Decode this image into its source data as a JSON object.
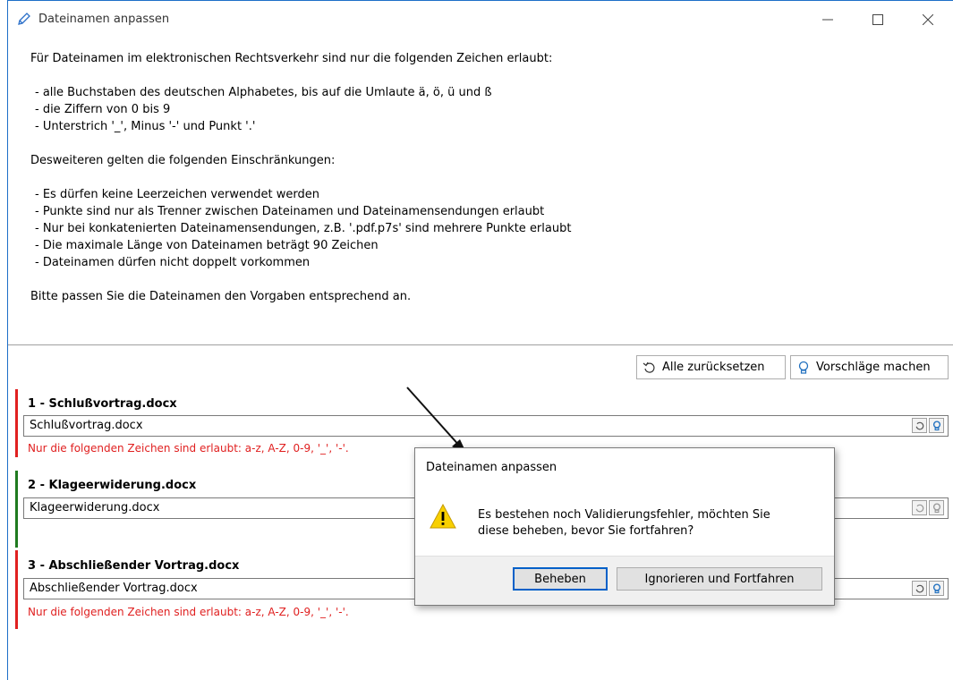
{
  "window": {
    "title": "Dateinamen anpassen"
  },
  "intro": {
    "heading1": "Für Dateinamen im elektronischen Rechtsverkehr sind nur die folgenden Zeichen erlaubt:",
    "allowed": [
      "- alle Buchstaben des deutschen Alphabetes, bis auf die Umlaute ä, ö, ü und ß",
      "- die Ziffern von 0 bis 9",
      "- Unterstrich '_', Minus '-' und Punkt '.'"
    ],
    "heading2": "Desweiteren gelten die folgenden Einschränkungen:",
    "restrictions": [
      "- Es dürfen keine Leerzeichen verwendet werden",
      "- Punkte sind nur als Trenner zwischen Dateinamen und Dateinamensendungen erlaubt",
      "- Nur bei konkatenierten Dateinamensendungen, z.B. '.pdf.p7s' sind mehrere Punkte erlaubt",
      "- Die maximale Länge von Dateinamen beträgt 90 Zeichen",
      "- Dateinamen dürfen nicht doppelt vorkommen"
    ],
    "closing": "Bitte passen Sie die Dateinamen den Vorgaben entsprechend an."
  },
  "toolbar": {
    "reset_label": "Alle zurücksetzen",
    "suggest_label": "Vorschläge machen"
  },
  "entries": [
    {
      "title": "1  - Schlußvortrag.docx",
      "value": "Schlußvortrag.docx",
      "error": "Nur die folgenden Zeichen sind erlaubt: a-z, A-Z, 0-9, '_', '-'.",
      "status": "error"
    },
    {
      "title": "2  - Klageerwiderung.docx",
      "value": "Klageerwiderung.docx",
      "error": "",
      "status": "ok"
    },
    {
      "title": "3  - Abschließender Vortrag.docx",
      "value": "Abschließender Vortrag.docx",
      "error": "Nur die folgenden Zeichen sind erlaubt: a-z, A-Z, 0-9, '_', '-'.",
      "status": "error"
    }
  ],
  "dialog": {
    "title": "Dateinamen anpassen",
    "message": "Es bestehen noch Validierungsfehler, möchten Sie diese beheben, bevor Sie fortfahren?",
    "primary_label": "Beheben",
    "secondary_label": "Ignorieren und Fortfahren"
  },
  "colors": {
    "error": "#e02020",
    "ok": "#1f7a1f",
    "accent": "#0060c8"
  }
}
